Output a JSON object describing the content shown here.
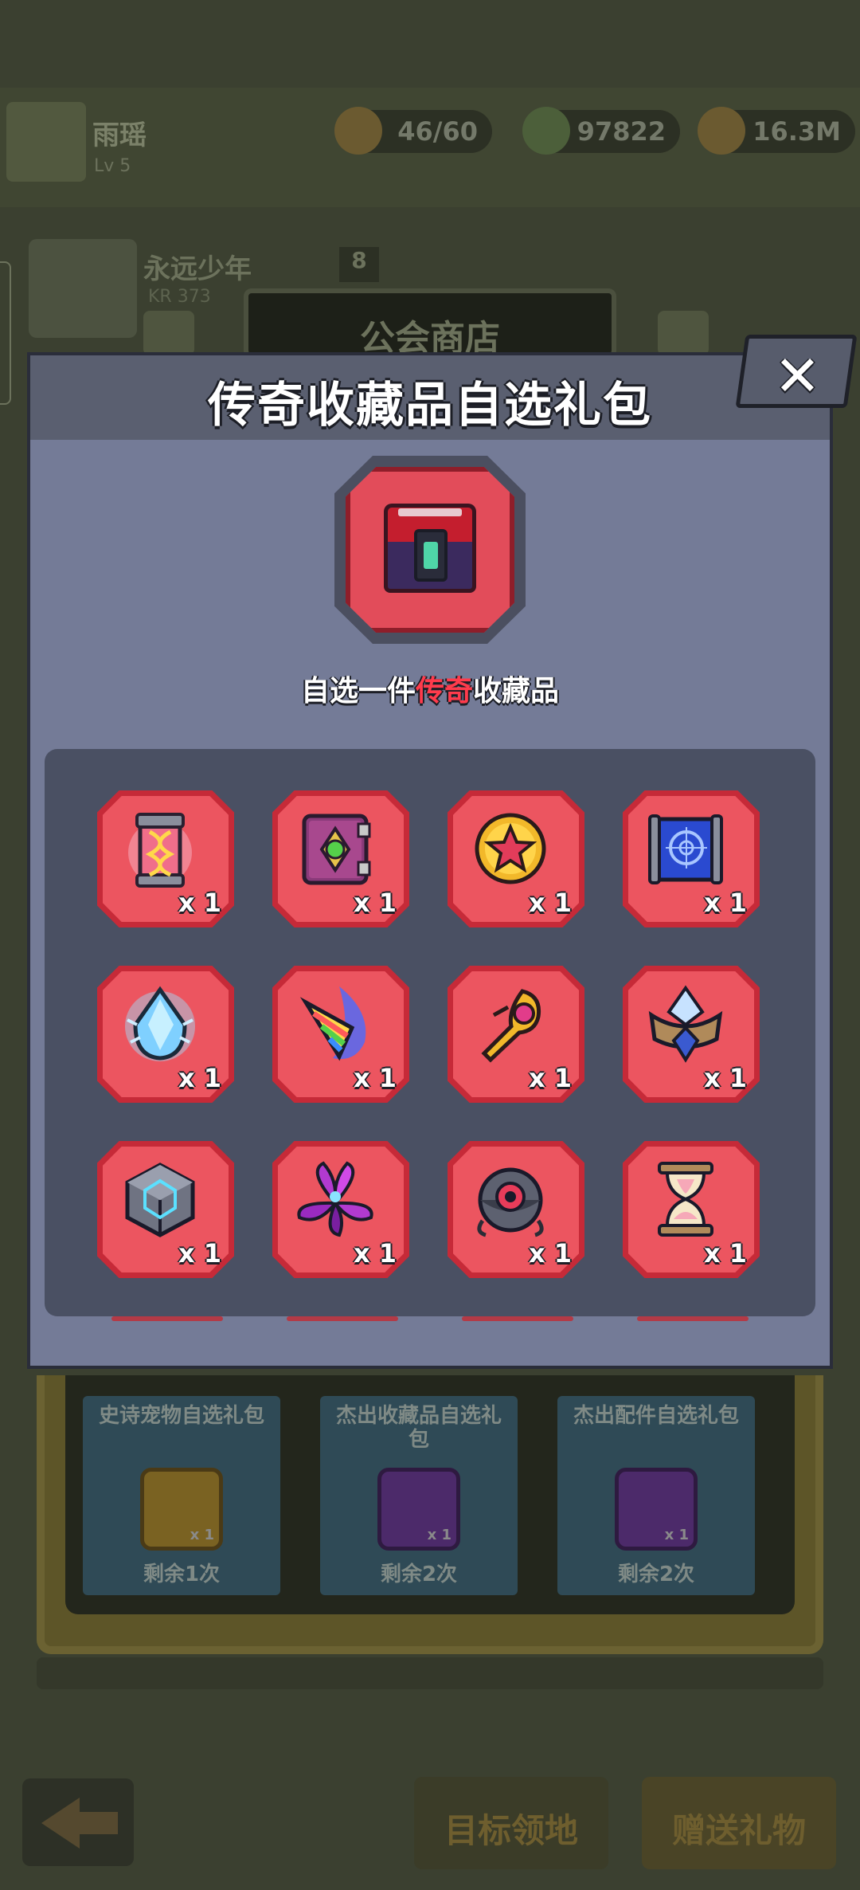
{
  "background": {
    "player_name": "雨瑶",
    "player_level": "Lv 5",
    "resources": [
      {
        "name": "stamina",
        "icon": "stamina-icon",
        "value": "46/60"
      },
      {
        "name": "gems",
        "icon": "gem-icon",
        "value": "97822"
      },
      {
        "name": "coins",
        "icon": "coin-icon",
        "value": "16.3M"
      }
    ],
    "guild_name": "永远少年",
    "guild_sub": "KR 373",
    "guild_num": "8",
    "shop_tab": "公会商店",
    "shop_cards": [
      {
        "title": "史诗宠物自选礼包",
        "remaining": "剩余1次",
        "color": "#f2b01e"
      },
      {
        "title": "杰出收藏品自选礼包",
        "remaining": "剩余2次",
        "color": "#8e3fd0"
      },
      {
        "title": "杰出配件自选礼包",
        "remaining": "剩余2次",
        "color": "#8e3fd0"
      }
    ],
    "bottom_buttons": [
      "目标领地",
      "赠送礼物"
    ]
  },
  "modal": {
    "title": "传奇收藏品自选礼包",
    "subtitle_prefix": "自选一件",
    "subtitle_highlight": "传奇",
    "subtitle_suffix": "收藏品",
    "close_label": "✕",
    "accent": "#ff3b4c",
    "items": [
      {
        "icon": "dna-capsule-icon",
        "qty": "x 1"
      },
      {
        "icon": "spellbook-icon",
        "qty": "x 1"
      },
      {
        "icon": "star-coin-icon",
        "qty": "x 1"
      },
      {
        "icon": "blueprint-icon",
        "qty": "x 1"
      },
      {
        "icon": "ice-crystal-icon",
        "qty": "x 1"
      },
      {
        "icon": "rainbow-horn-icon",
        "qty": "x 1"
      },
      {
        "icon": "ruby-scepter-icon",
        "qty": "x 1"
      },
      {
        "icon": "crystal-crown-icon",
        "qty": "x 1"
      },
      {
        "icon": "tech-cube-icon",
        "qty": "x 1"
      },
      {
        "icon": "magic-lily-icon",
        "qty": "x 1"
      },
      {
        "icon": "eye-orb-icon",
        "qty": "x 1"
      },
      {
        "icon": "hourglass-icon",
        "qty": "x 1"
      }
    ]
  }
}
